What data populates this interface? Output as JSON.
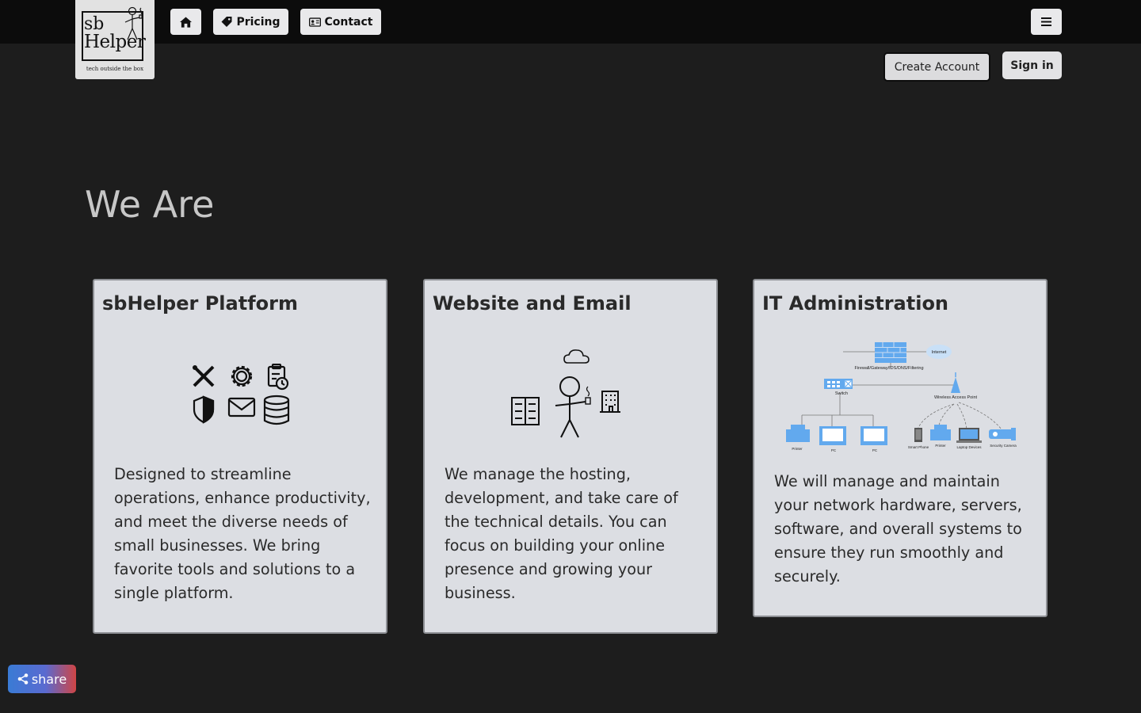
{
  "logo": {
    "line1": "sb",
    "line2": "Helper",
    "tagline": "tech outside the box"
  },
  "nav": {
    "pricing_label": "Pricing",
    "contact_label": "Contact"
  },
  "account": {
    "create_label": "Create Account",
    "signin_label": "Sign in"
  },
  "page": {
    "heading": "We Are"
  },
  "cards": [
    {
      "title": "sbHelper Platform",
      "description": "Designed to streamline operations, enhance productivity, and meet the diverse needs of small businesses. We bring favorite tools and solutions to a single platform."
    },
    {
      "title": "Website and Email",
      "description": "We manage the hosting, development, and take care of the technical details. You can focus on building your online presence and growing your business."
    },
    {
      "title": "IT Administration",
      "description": "We will manage and maintain your network hardware, servers, software, and overall systems to ensure they run smoothly and securely.",
      "diagram": {
        "firewall": "Firewall/Gateway/IDS/DNS/Filtering",
        "internet": "Internet",
        "switch": "Switch",
        "wap": "Wireless Access Point",
        "devices": [
          "Printer",
          "PC",
          "PC",
          "Smart Phone",
          "Printer",
          "Laptop Devices",
          "Security Camera"
        ]
      }
    }
  ],
  "share": {
    "label": "share"
  },
  "colors": {
    "topbar": "#0c0c0c",
    "background": "#1d1d1d",
    "card": "#dcdee3",
    "diagram_blue": "#62a9ee"
  }
}
